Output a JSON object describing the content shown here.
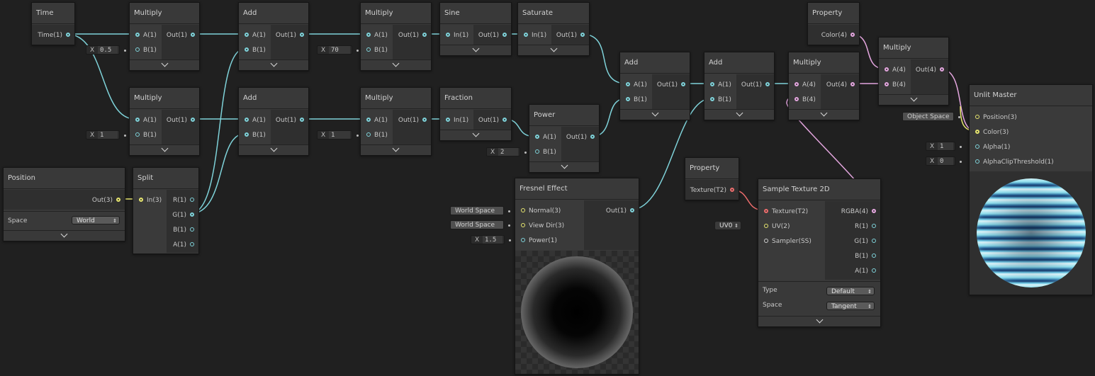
{
  "colors": {
    "vector1": "#7fd3da",
    "vector3": "#e7e66f",
    "vector4": "#e4a6df",
    "texture": "#ed6d6d",
    "background": "#202020"
  },
  "nodes": {
    "time": {
      "title": "Time",
      "out": "Time(1)"
    },
    "mul1": {
      "title": "Multiply",
      "a": "A(1)",
      "b": "B(1)",
      "out": "Out(1)",
      "b_value": "0.5"
    },
    "add1": {
      "title": "Add",
      "a": "A(1)",
      "b": "B(1)",
      "out": "Out(1)"
    },
    "mul2": {
      "title": "Multiply",
      "a": "A(1)",
      "b": "B(1)",
      "out": "Out(1)",
      "b_value": "70"
    },
    "sine": {
      "title": "Sine",
      "in": "In(1)",
      "out": "Out(1)"
    },
    "saturate": {
      "title": "Saturate",
      "in": "In(1)",
      "out": "Out(1)"
    },
    "mul3": {
      "title": "Multiply",
      "a": "A(1)",
      "b": "B(1)",
      "out": "Out(1)",
      "b_value": "1"
    },
    "add2": {
      "title": "Add",
      "a": "A(1)",
      "b": "B(1)",
      "out": "Out(1)"
    },
    "mul4": {
      "title": "Multiply",
      "a": "A(1)",
      "b": "B(1)",
      "out": "Out(1)",
      "b_value": "1"
    },
    "fraction": {
      "title": "Fraction",
      "in": "In(1)",
      "out": "Out(1)"
    },
    "power": {
      "title": "Power",
      "a": "A(1)",
      "b": "B(1)",
      "out": "Out(1)",
      "b_value": "2"
    },
    "add3": {
      "title": "Add",
      "a": "A(1)",
      "b": "B(1)",
      "out": "Out(1)"
    },
    "add4": {
      "title": "Add",
      "a": "A(1)",
      "b": "B(1)",
      "out": "Out(1)"
    },
    "mul5": {
      "title": "Multiply",
      "a": "A(4)",
      "b": "B(4)",
      "out": "Out(4)"
    },
    "prop_color": {
      "title": "Property",
      "out": "Color(4)"
    },
    "mul6": {
      "title": "Multiply",
      "a": "A(4)",
      "b": "B(4)",
      "out": "Out(4)"
    },
    "position": {
      "title": "Position",
      "out": "Out(3)",
      "space_label": "Space",
      "space_value": "World"
    },
    "split": {
      "title": "Split",
      "in": "In(3)",
      "r": "R(1)",
      "g": "G(1)",
      "b": "B(1)",
      "a": "A(1)"
    },
    "fresnel": {
      "title": "Fresnel Effect",
      "normal": "Normal(3)",
      "viewdir": "View Dir(3)",
      "power": "Power(1)",
      "out": "Out(1)",
      "normal_value": "World Space",
      "viewdir_value": "World Space",
      "power_value": "1.5"
    },
    "prop_tex": {
      "title": "Property",
      "out": "Texture(T2)"
    },
    "sample": {
      "title": "Sample Texture 2D",
      "texture": "Texture(T2)",
      "uv": "UV(2)",
      "sampler": "Sampler(SS)",
      "rgba": "RGBA(4)",
      "r": "R(1)",
      "g": "G(1)",
      "b": "B(1)",
      "a": "A(1)",
      "uv_value": "UV0",
      "type_label": "Type",
      "type_value": "Default",
      "space_label": "Space",
      "space_value": "Tangent"
    },
    "master": {
      "title": "Unlit Master",
      "position": "Position(3)",
      "color": "Color(3)",
      "alpha": "Alpha(1)",
      "alphaclip": "AlphaClipThreshold(1)",
      "position_value": "Object Space",
      "alpha_value": "1",
      "alphaclip_value": "0"
    }
  },
  "field_prefix": "X"
}
